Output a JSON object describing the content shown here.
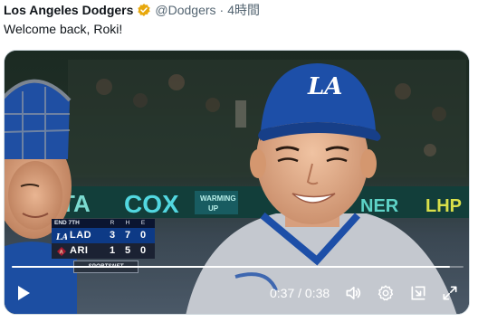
{
  "post": {
    "author_name": "Los Angeles Dodgers",
    "handle": "@Dodgers",
    "separator": "·",
    "time": "4時間",
    "text": "Welcome back, Roki!"
  },
  "scoreboard": {
    "inning": "END 7TH",
    "columns": [
      "R",
      "H",
      "E"
    ],
    "teams": [
      {
        "abbr": "LAD",
        "runs": "3",
        "hits": "7",
        "errors": "0"
      },
      {
        "abbr": "ARI",
        "runs": "1",
        "hits": "5",
        "errors": "0"
      }
    ],
    "network": "SPORTSNET"
  },
  "player": {
    "current_time": "0:37",
    "duration": "0:38",
    "time_separator": "/",
    "progress_fraction": 0.97
  },
  "colors": {
    "verified_badge": "#e8a80c",
    "dodgers_blue": "#1d4fa8",
    "ari_red": "#a71930"
  },
  "icons": {
    "verified": "verified-badge-icon",
    "play": "play-icon",
    "volume": "volume-icon",
    "settings": "settings-gear-icon",
    "pip": "picture-in-picture-icon",
    "fullscreen": "fullscreen-icon"
  }
}
